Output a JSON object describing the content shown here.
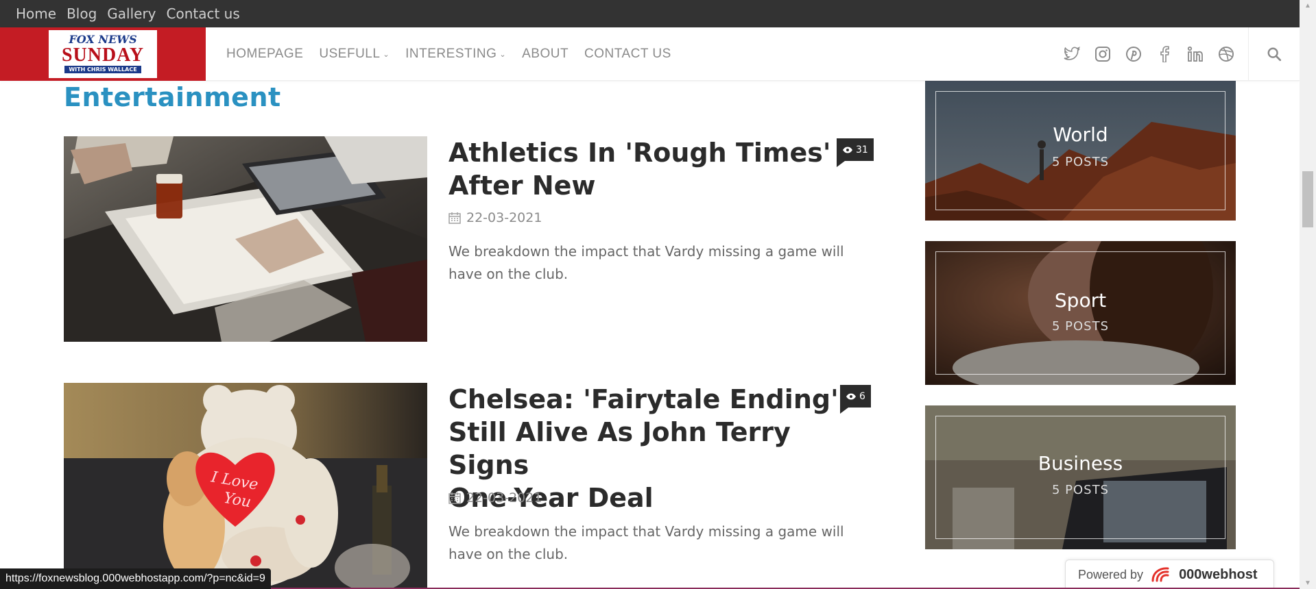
{
  "topbar": {
    "links": [
      "Home",
      "Blog",
      "Gallery",
      "Contact us"
    ]
  },
  "logo": {
    "line1": "FOX NEWS",
    "line2": "SUNDAY",
    "line3": "WITH CHRIS WALLACE"
  },
  "nav": {
    "items": [
      {
        "label": "HOMEPAGE"
      },
      {
        "label": "USEFULL"
      },
      {
        "label": "INTERESTING"
      },
      {
        "label": "ABOUT"
      },
      {
        "label": "CONTACT US"
      }
    ],
    "social_icons": [
      "twitter-icon",
      "instagram-icon",
      "pinterest-icon",
      "facebook-icon",
      "linkedin-icon",
      "dribbble-icon"
    ],
    "search_icon": "search-icon"
  },
  "section": {
    "title": "Entertainment"
  },
  "posts": [
    {
      "title_line1": "Athletics In 'Rough Times'",
      "title_line2": "After New",
      "date": "22-03-2021",
      "excerpt_line1": "We breakdown the impact that Vardy missing a game will",
      "excerpt_line2": "have on the club.",
      "views": "31"
    },
    {
      "title_line1": "Chelsea: 'Fairytale Ending'",
      "title_line2": "Still Alive As John Terry Signs",
      "title_line3": "One-Year Deal",
      "date": "22-03-2021",
      "excerpt_line1": "We breakdown the impact that Vardy missing a game will",
      "excerpt_line2": "have on the club.",
      "views": "6",
      "image_text_1": "I Love",
      "image_text_2": "You"
    }
  ],
  "categories": [
    {
      "name": "World",
      "count": "5 POSTS"
    },
    {
      "name": "Sport",
      "count": "5 POSTS"
    },
    {
      "name": "Business",
      "count": "5 POSTS"
    }
  ],
  "status_url": "https://foxnewsblog.000webhostapp.com/?p=nc&id=9",
  "powered": {
    "label": "Powered by",
    "brand": "000webhost"
  },
  "colors": {
    "topbar": "#333333",
    "logo_bg": "#c41c24",
    "section_title": "#2a91c1",
    "post_title": "#2b2b2b",
    "nav_text": "#8a8a8a"
  }
}
